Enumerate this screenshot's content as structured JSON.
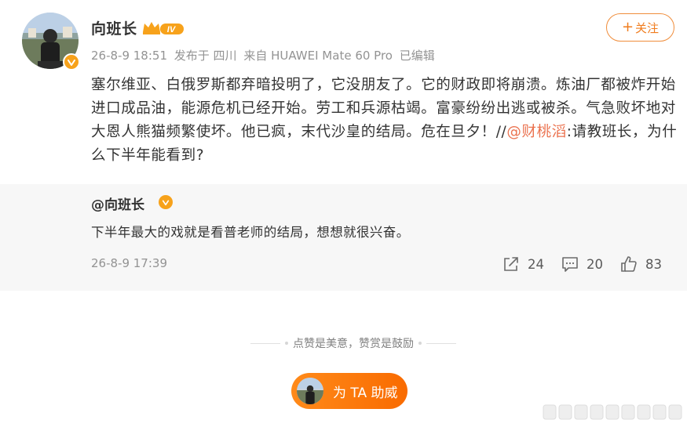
{
  "post": {
    "author": "向班长",
    "meta": {
      "time": "26-8-9 18:51",
      "location": "发布于 四川",
      "device": "来自 HUAWEI Mate 60 Pro",
      "edited": "已编辑"
    },
    "follow_label": "关注",
    "follow_plus": "+",
    "text_main": "塞尔维亚、白俄罗斯都弃暗投明了，它没朋友了。它的财政即将崩溃。炼油厂都被炸开始进口成品油，能源危机已经开始。劳工和兵源枯竭。富豪纷纷出逃或被杀。气急败坏地对大恩人熊猫频繁使坏。他已疯，末代沙皇的结局。危在旦夕！//",
    "mention": "@财桃滔",
    "text_tail": ":请教班长，为什么下半年能看到?",
    "vip_level": "IV"
  },
  "repost": {
    "author": "@向班长",
    "text": "下半年最大的戏就是看普老师的结局，想想就很兴奋。",
    "time": "26-8-9 17:39",
    "actions": {
      "share_count": "24",
      "comment_count": "20",
      "like_count": "83"
    }
  },
  "footer": {
    "reward_hint": "点赞是美意，赞赏是鼓励",
    "reward_button": "为 TA 助威"
  },
  "colors": {
    "accent": "#f07c1d",
    "mention": "#eb7350",
    "verified": "#f7a21b",
    "reward_gradient_start": "#ff8a1a",
    "reward_gradient_end": "#f96b00"
  }
}
